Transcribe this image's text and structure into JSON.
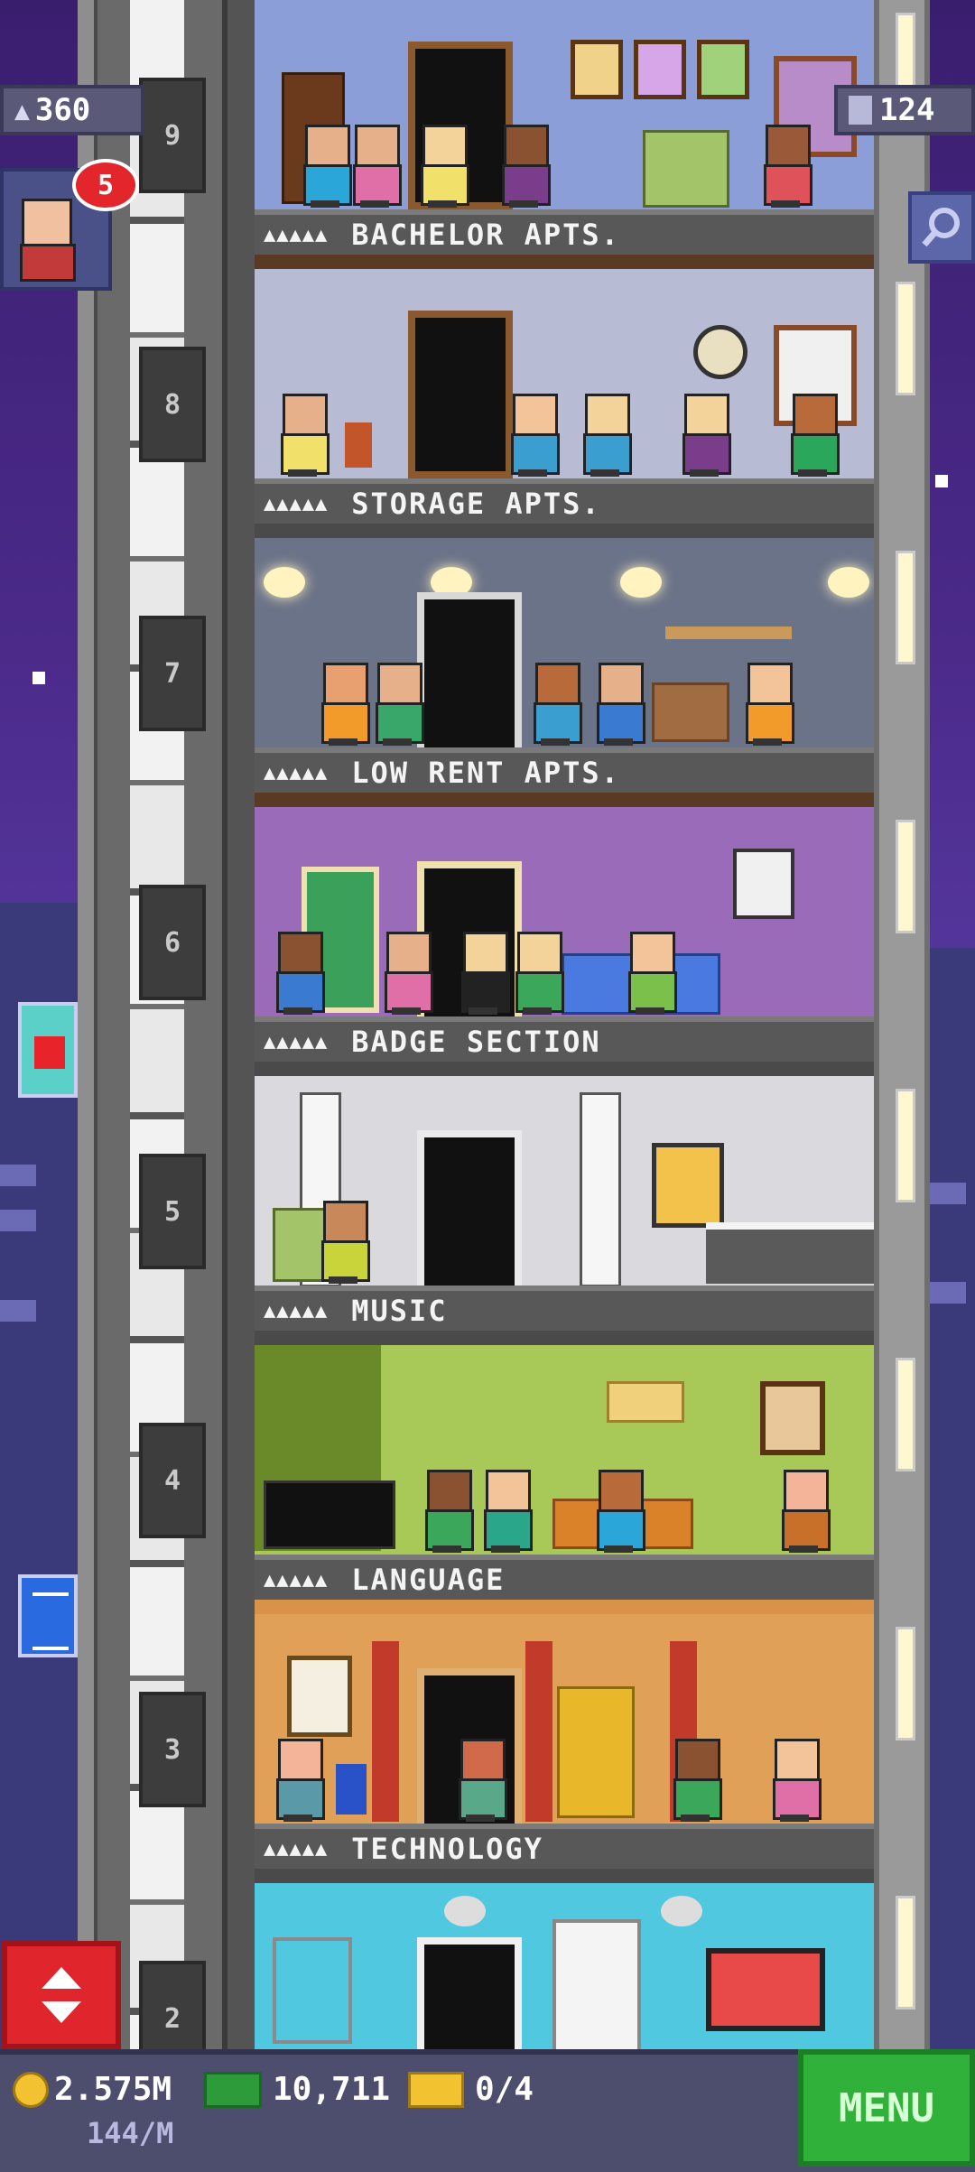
{
  "hud": {
    "population": "360",
    "bux_floors": "124",
    "notification_count": "5"
  },
  "floors": [
    {
      "number": "9",
      "name": "BACHELOR APTS."
    },
    {
      "number": "8",
      "name": "STORAGE APTS."
    },
    {
      "number": "7",
      "name": "LOW RENT APTS."
    },
    {
      "number": "6",
      "name": "BADGE SECTION"
    },
    {
      "number": "5",
      "name": "MUSIC"
    },
    {
      "number": "4",
      "name": "LANGUAGE"
    },
    {
      "number": "3",
      "name": "TECHNOLOGY"
    },
    {
      "number": "2",
      "name": ""
    }
  ],
  "floor_people_marks": "▲▲▲▲▲",
  "bottom": {
    "coins": "2.575M",
    "coins_rate": "144/M",
    "bux": "10,711",
    "tickets": "0/4",
    "menu_label": "MENU"
  },
  "colors": {
    "menu_green": "#2fb13a",
    "elevator_red": "#e0252c",
    "badge_red": "#e2262c",
    "coin_gold": "#f2c230",
    "bux_green": "#2d9b3a"
  },
  "icons": {
    "population": "person-icon",
    "floors": "building-icon",
    "search": "magnifier-icon",
    "elevator": "up-down-arrows-icon",
    "coin": "coin-icon",
    "bux": "banknote-icon",
    "ticket": "ticket-icon"
  }
}
